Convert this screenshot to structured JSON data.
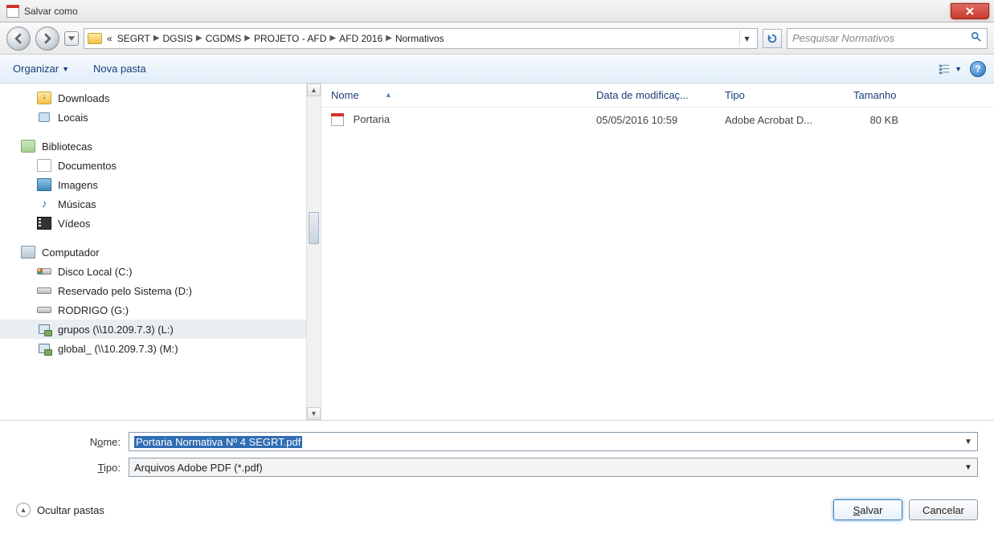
{
  "window": {
    "title": "Salvar como"
  },
  "path": {
    "prefix": "«",
    "crumbs": [
      "SEGRT",
      "DGSIS",
      "CGDMS",
      "PROJETO - AFD",
      "AFD 2016",
      "Normativos"
    ]
  },
  "search": {
    "placeholder": "Pesquisar Normativos"
  },
  "toolbar": {
    "organize": "Organizar",
    "new_folder": "Nova pasta"
  },
  "tree": {
    "downloads": "Downloads",
    "places": "Locais",
    "libraries": "Bibliotecas",
    "documents": "Documentos",
    "images": "Imagens",
    "music": "Músicas",
    "videos": "Vídeos",
    "computer": "Computador",
    "drive_c": "Disco Local (C:)",
    "drive_d": "Reservado pelo Sistema (D:)",
    "drive_g": "RODRIGO (G:)",
    "drive_l": "grupos (\\\\10.209.7.3) (L:)",
    "drive_m": "global_ (\\\\10.209.7.3) (M:)"
  },
  "columns": {
    "name": "Nome",
    "date": "Data de modificaç...",
    "type": "Tipo",
    "size": "Tamanho"
  },
  "files": [
    {
      "name": "Portaria",
      "date": "05/05/2016 10:59",
      "type": "Adobe Acrobat D...",
      "size": "80 KB"
    }
  ],
  "fields": {
    "name_label_pre": "N",
    "name_label_ul": "o",
    "name_label_post": "me:",
    "name_value": "Portaria Normativa Nº 4 SEGRT.pdf",
    "type_label_pre": "",
    "type_label_ul": "T",
    "type_label_post": "ipo:",
    "type_value": "Arquivos Adobe PDF (*.pdf)"
  },
  "footer": {
    "hide": "Ocultar pastas",
    "save_pre": "",
    "save_ul": "S",
    "save_post": "alvar",
    "cancel": "Cancelar"
  },
  "help": "?"
}
